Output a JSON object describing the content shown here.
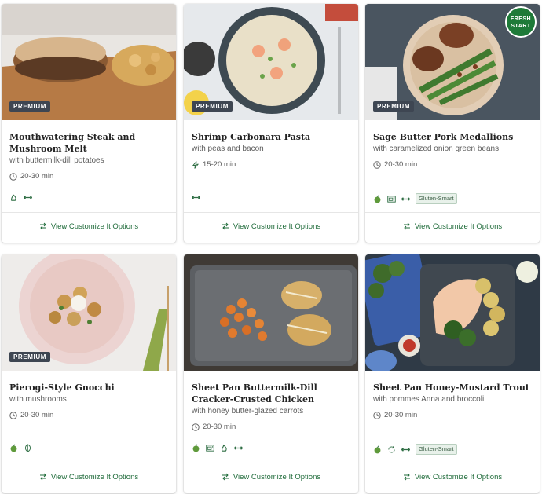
{
  "colors": {
    "accent_green": "#1f6b3a",
    "badge_bg": "#3e4652",
    "pill_bg": "#e8f1ea",
    "fresh_start_green": "#1e7a38"
  },
  "cards": [
    {
      "title": "Mouthwatering Steak and Mushroom Melt",
      "subtitle": "with buttermilk-dill potatoes",
      "time": "20-30 min",
      "time_icon": "clock-icon",
      "badge": "PREMIUM",
      "tags": [
        "calorie-icon",
        "protein-icon"
      ],
      "pill": "",
      "customize_label": "View Customize It Options"
    },
    {
      "title": "Shrimp Carbonara Pasta",
      "subtitle": "with peas and bacon",
      "time": "15-20 min",
      "time_icon": "lightning-icon",
      "badge": "PREMIUM",
      "tags": [
        "protein-icon"
      ],
      "pill": "",
      "customize_label": "View Customize It Options"
    },
    {
      "title": "Sage Butter Pork Medallions",
      "subtitle": "with caramelized onion green beans",
      "time": "20-30 min",
      "time_icon": "clock-icon",
      "badge": "PREMIUM",
      "fresh_start": "FRESH START",
      "tags": [
        "apple-icon",
        "oven-icon",
        "protein-icon"
      ],
      "pill": "Gluten-Smart",
      "customize_label": "View Customize It Options"
    },
    {
      "title": "Pierogi-Style Gnocchi",
      "subtitle": "with mushrooms",
      "time": "20-30 min",
      "time_icon": "clock-icon",
      "badge": "PREMIUM",
      "tags": [
        "apple-icon",
        "leaf-icon"
      ],
      "pill": "",
      "customize_label": "View Customize It Options"
    },
    {
      "title": "Sheet Pan Buttermilk-Dill Cracker-Crusted Chicken",
      "subtitle": "with honey butter-glazed carrots",
      "time": "20-30 min",
      "time_icon": "clock-icon",
      "badge": "",
      "tags": [
        "apple-icon",
        "oven-icon",
        "calorie-icon",
        "protein-icon"
      ],
      "pill": "",
      "customize_label": "View Customize It Options"
    },
    {
      "title": "Sheet Pan Honey-Mustard Trout",
      "subtitle": "with pommes Anna and broccoli",
      "time": "20-30 min",
      "time_icon": "clock-icon",
      "badge": "",
      "tags": [
        "apple-icon",
        "recycle-icon",
        "protein-icon"
      ],
      "pill": "Gluten-Smart",
      "customize_label": "View Customize It Options"
    }
  ]
}
